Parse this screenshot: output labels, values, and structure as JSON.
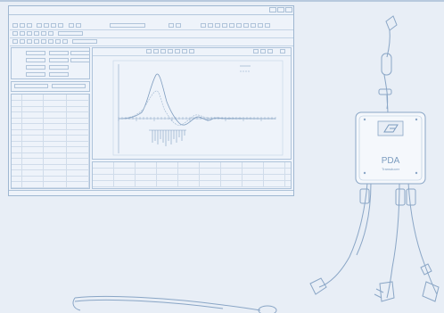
{
  "window": {
    "title": "",
    "controls": [
      "",
      "",
      ""
    ]
  },
  "menu": {
    "items": [
      "",
      "",
      "",
      "",
      "",
      "",
      "",
      "",
      ""
    ]
  },
  "toolbars": [
    {
      "field": ""
    },
    {
      "field": ""
    },
    {
      "field": ""
    }
  ],
  "left_panel": {
    "rows": [
      {
        "label": "",
        "value": ""
      },
      {
        "label": "",
        "value": ""
      },
      {
        "label": "",
        "value": ""
      },
      {
        "label": "",
        "value": ""
      }
    ],
    "tabs": [
      "",
      ""
    ]
  },
  "table": {
    "headers": [
      "",
      "",
      "",
      ""
    ],
    "rows": [
      [
        "",
        "",
        "",
        ""
      ],
      [
        "",
        "",
        "",
        ""
      ],
      [
        "",
        "",
        "",
        ""
      ],
      [
        "",
        "",
        "",
        ""
      ],
      [
        "",
        "",
        "",
        ""
      ],
      [
        "",
        "",
        "",
        ""
      ],
      [
        "",
        "",
        "",
        ""
      ],
      [
        "",
        "",
        "",
        ""
      ],
      [
        "",
        "",
        "",
        ""
      ],
      [
        "",
        "",
        "",
        ""
      ],
      [
        "",
        "",
        "",
        ""
      ],
      [
        "",
        "",
        "",
        ""
      ],
      [
        "",
        "",
        "",
        ""
      ],
      [
        "",
        "",
        "",
        ""
      ],
      [
        "",
        "",
        "",
        ""
      ],
      [
        "",
        "",
        "",
        ""
      ]
    ]
  },
  "chart": {
    "title": "",
    "y_unit": "",
    "x_unit": "",
    "legend": [
      "",
      ""
    ]
  },
  "bottom_grid": {
    "rows": [
      [
        "",
        "",
        "",
        "",
        "",
        "",
        "",
        "",
        ""
      ],
      [
        "",
        "",
        "",
        "",
        "",
        "",
        "",
        "",
        ""
      ],
      [
        "",
        "",
        "",
        "",
        "",
        "",
        "",
        "",
        ""
      ],
      [
        "",
        "",
        "",
        "",
        "",
        "",
        "",
        "",
        ""
      ]
    ]
  },
  "status_bar": "",
  "device": {
    "brand": "PDA",
    "model": "Transducer",
    "badge": "",
    "port_labels": [
      "",
      ""
    ]
  },
  "colors": {
    "background": "#e8eef6",
    "line": "#8aa6c6",
    "panel": "#eef3fa",
    "device": "#f5f8fc"
  }
}
